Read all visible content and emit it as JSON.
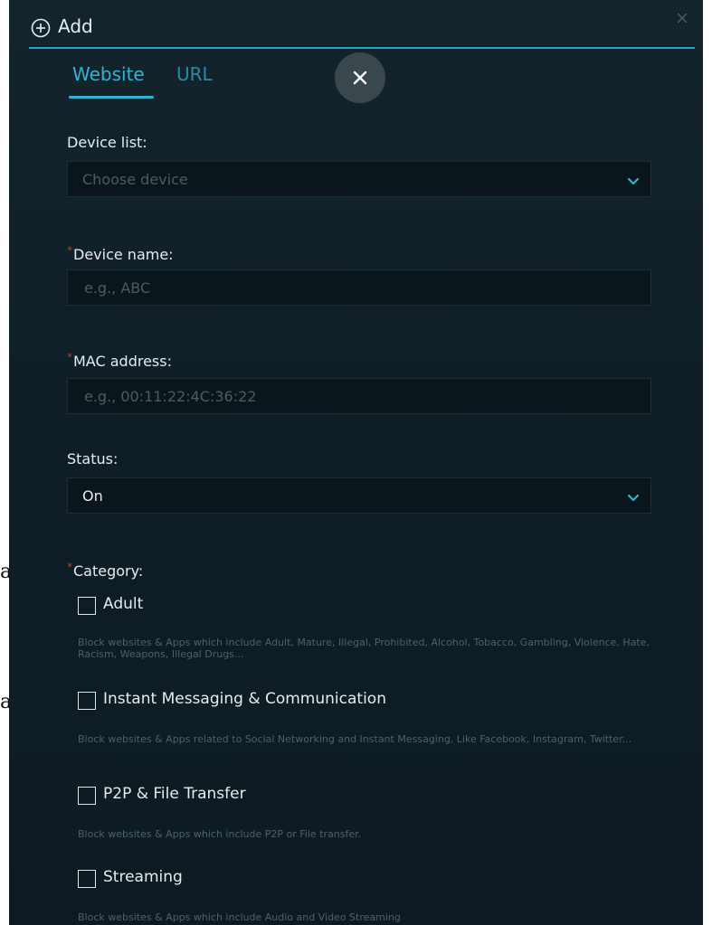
{
  "edge_text": {
    "line1": "an",
    "line2": "an"
  },
  "header": {
    "title": "Add"
  },
  "tabs": [
    {
      "label": "Website"
    },
    {
      "label": "URL"
    }
  ],
  "form": {
    "device_list": {
      "label": "Device list:",
      "placeholder": "Choose device"
    },
    "device_name": {
      "required_mark": "*",
      "label": "Device name:",
      "placeholder": "e.g., ABC"
    },
    "mac_address": {
      "required_mark": "*",
      "label": "MAC address:",
      "placeholder": "e.g., 00:11:22:4C:36:22"
    },
    "status": {
      "label": "Status:",
      "value": "On"
    },
    "category": {
      "required_mark": "*",
      "label": "Category:",
      "items": [
        {
          "label": "Adult",
          "checked": false,
          "description": "Block websites & Apps which include Adult, Mature, Illegal, Prohibited, Alcohol, Tobacco, Gambling, Violence, Hate, Racism, Weapons, Illegal Drugs..."
        },
        {
          "label": "Instant Messaging & Communication",
          "checked": false,
          "description": "Block websites & Apps related to Social Networking and Instant Messaging, Like Facebook, Instagram, Twitter..."
        },
        {
          "label": "P2P & File Transfer",
          "checked": false,
          "description": "Block websites & Apps which include P2P or File transfer."
        },
        {
          "label": "Streaming",
          "checked": false,
          "description": "Block websites & Apps which include Audio and Video Streaming"
        }
      ]
    }
  },
  "colors": {
    "accent": "#33b3d0",
    "panel_bg": "#13232b",
    "field_bg": "#0b161c",
    "required": "#c0392b"
  },
  "icons": {
    "add": "plus-circle-icon",
    "close": "close-icon",
    "dropdown": "chevron-down-icon"
  }
}
